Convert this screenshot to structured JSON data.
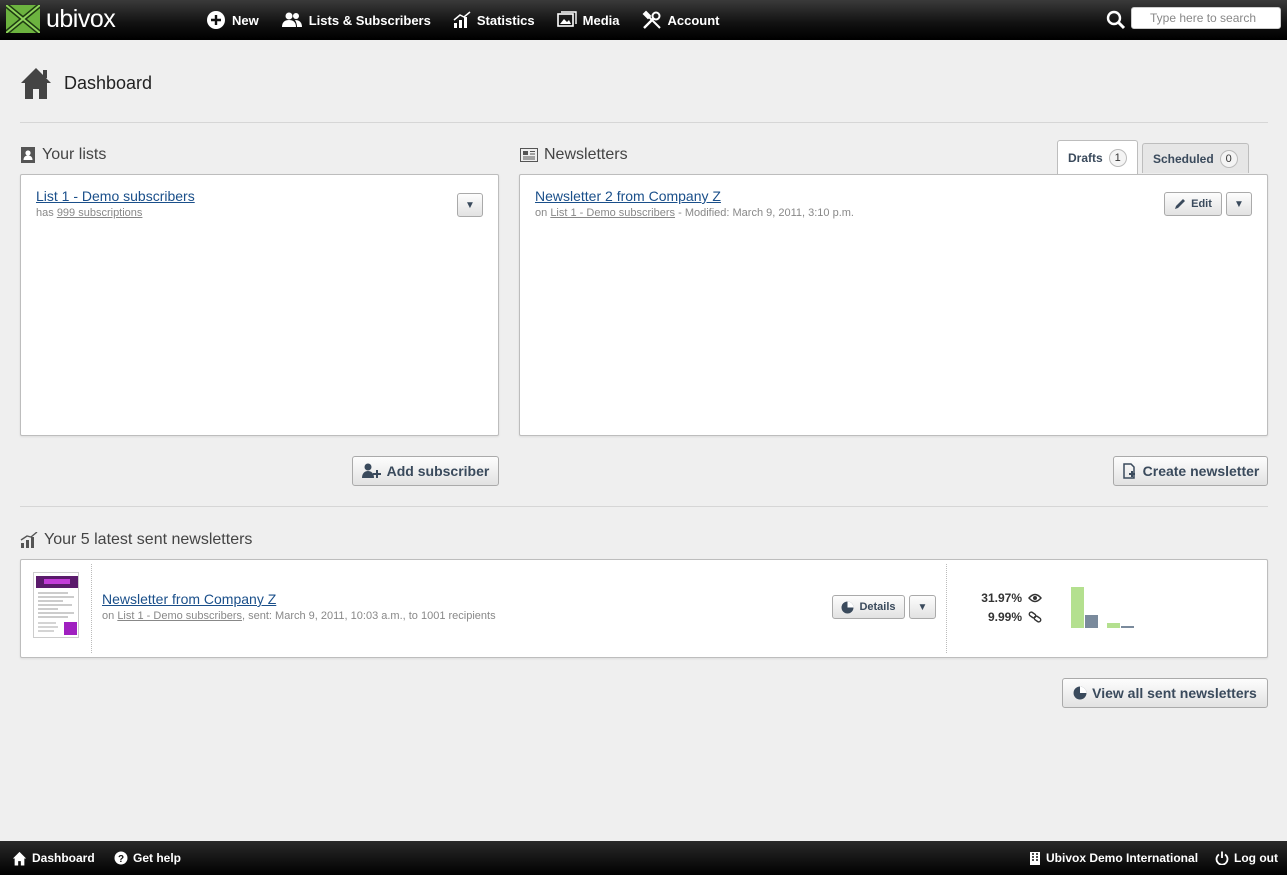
{
  "app": {
    "logo_text": "ubivox"
  },
  "nav": {
    "items": [
      {
        "label": "New",
        "icon": "plus-circle-icon"
      },
      {
        "label": "Lists & Subscribers",
        "icon": "users-icon"
      },
      {
        "label": "Statistics",
        "icon": "chart-icon"
      },
      {
        "label": "Media",
        "icon": "images-icon"
      },
      {
        "label": "Account",
        "icon": "tools-icon"
      }
    ],
    "search_placeholder": "Type here to search"
  },
  "page": {
    "title": "Dashboard"
  },
  "lists": {
    "title": "Your lists",
    "item": {
      "name": "List 1 - Demo subscribers",
      "has_prefix": "has",
      "subscriptions": "999 subscriptions"
    },
    "add_subscriber_label": "Add subscriber"
  },
  "newsletters": {
    "title": "Newsletters",
    "tabs": [
      {
        "label": "Drafts",
        "count": "1"
      },
      {
        "label": "Scheduled",
        "count": "0"
      }
    ],
    "item": {
      "name": "Newsletter 2 from Company Z",
      "on_prefix": "on",
      "list": "List 1 - Demo subscribers",
      "modified": "- Modified: March 9, 2011, 3:10 p.m."
    },
    "edit_label": "Edit",
    "create_label": "Create newsletter"
  },
  "sent": {
    "title": "Your 5 latest sent newsletters",
    "item": {
      "name": "Newsletter from Company Z",
      "on_prefix": "on",
      "list": "List 1 - Demo subscribers",
      "details": ", sent: March 9, 2011, 10:03 a.m., to 1001 recipients",
      "open_rate": "31.97%",
      "click_rate": "9.99%"
    },
    "details_label": "Details",
    "view_all_label": "View all sent newsletters"
  },
  "footer": {
    "dashboard_label": "Dashboard",
    "help_label": "Get help",
    "org_label": "Ubivox Demo International",
    "logout_label": "Log out"
  },
  "colors": {
    "accent_green": "#6cb33f",
    "link": "#1a4f8a",
    "bar_green": "#b4e08f",
    "bar_slate": "#7a8a9c"
  }
}
